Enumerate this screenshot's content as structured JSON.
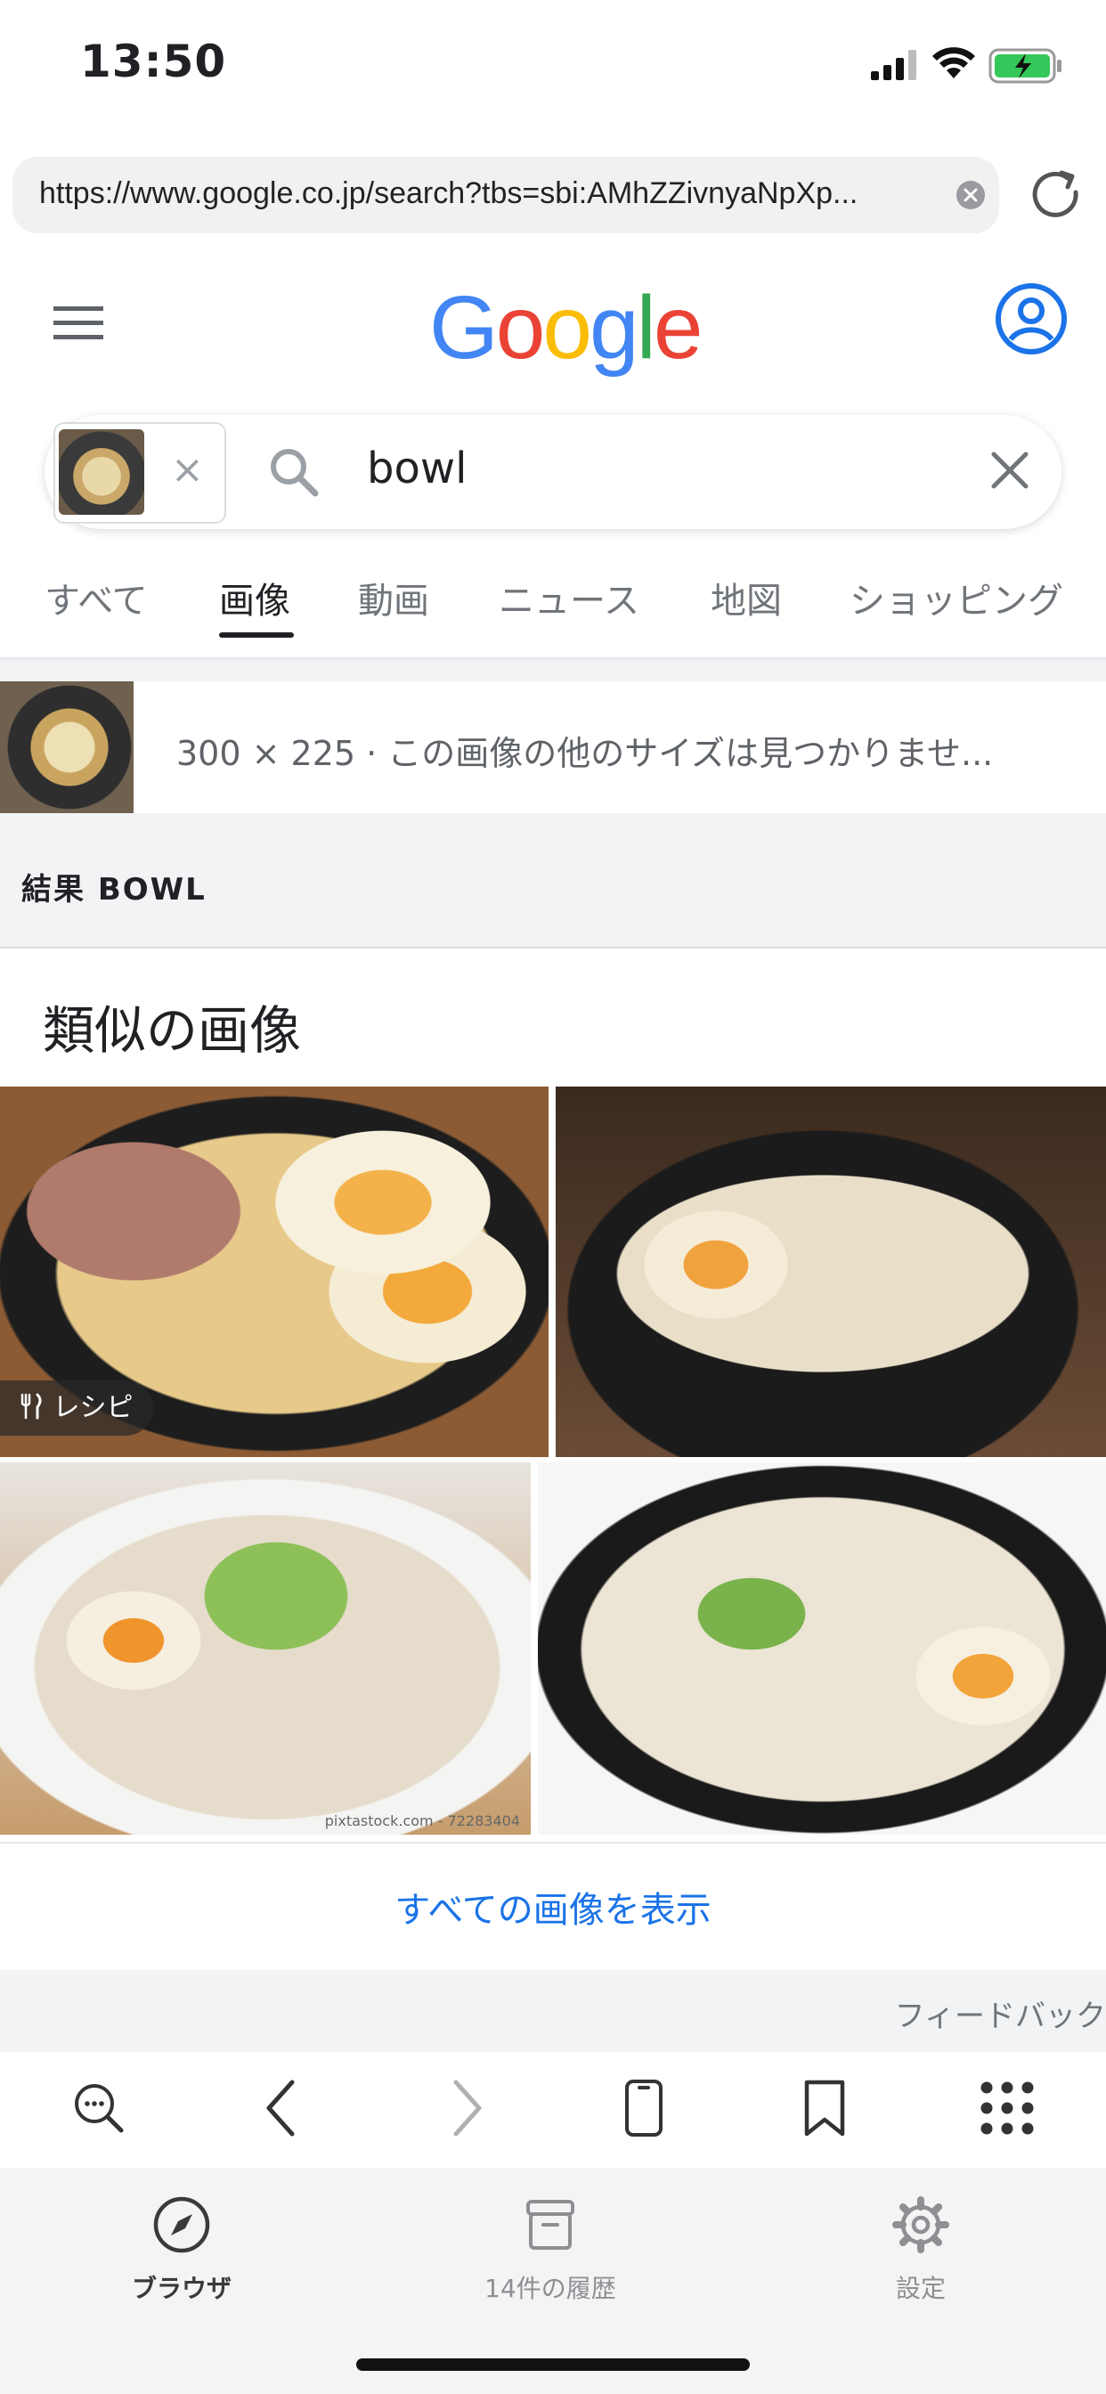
{
  "status_bar": {
    "time": "13:50"
  },
  "browser": {
    "url": "https://www.google.co.jp/search?tbs=sbi:AMhZZivnyaNpXp..."
  },
  "google": {
    "logo_letters": [
      {
        "ch": "G",
        "color": "#4285F4"
      },
      {
        "ch": "o",
        "color": "#EA4335"
      },
      {
        "ch": "o",
        "color": "#FBBC05"
      },
      {
        "ch": "g",
        "color": "#4285F4"
      },
      {
        "ch": "l",
        "color": "#34A853"
      },
      {
        "ch": "e",
        "color": "#EA4335"
      }
    ],
    "accent": "#1a73e8"
  },
  "search": {
    "query": "bowl",
    "chip_close": "×"
  },
  "tabs": [
    "すべて",
    "画像",
    "動画",
    "ニュース",
    "地図",
    "ショッピング"
  ],
  "source_image": {
    "text": "300 × 225 · この画像の他のサイズは見つかりませ..."
  },
  "results": {
    "label": "結果 BOWL"
  },
  "similar": {
    "title": "類似の画像",
    "recipe_badge": "レシピ",
    "photo_caption": "pixtastock.com - 72283404",
    "show_all": "すべての画像を表示",
    "feedback": "フィードバック"
  },
  "toolbar_icons": [
    "search-icon",
    "back-icon",
    "forward-icon",
    "device-icon",
    "bookmark-icon",
    "grid-icon"
  ],
  "tabbar": {
    "browser": "ブラウザ",
    "history": "14件の履歴",
    "settings": "設定"
  }
}
